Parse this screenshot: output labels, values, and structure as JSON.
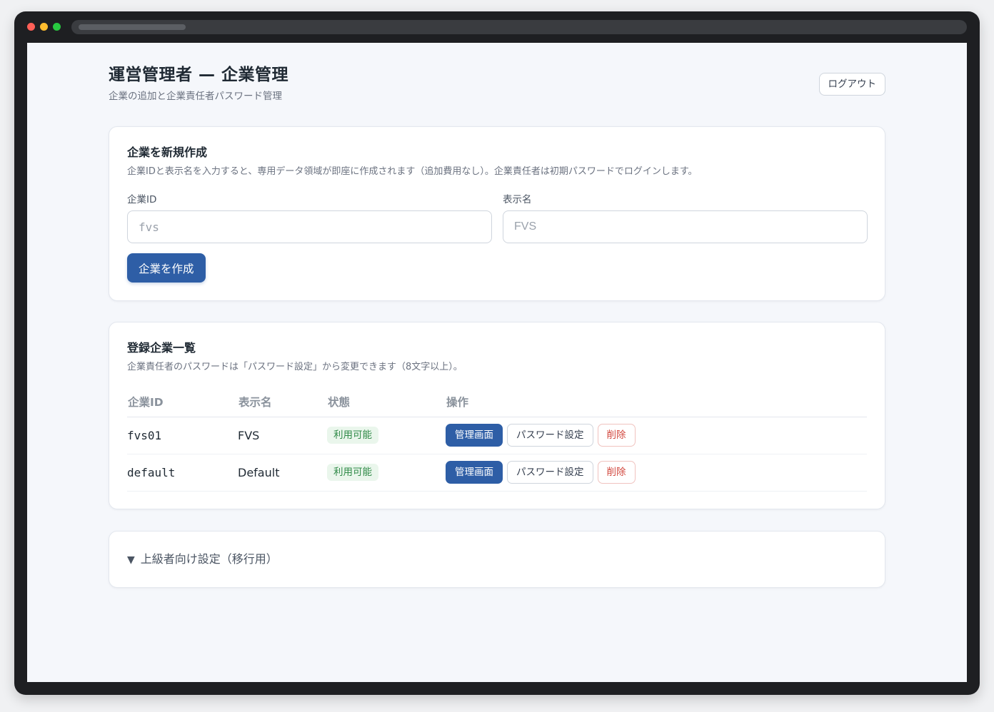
{
  "header": {
    "title": "運営管理者 — 企業管理",
    "subtitle": "企業の追加と企業責任者パスワード管理",
    "logout_label": "ログアウト"
  },
  "create": {
    "title": "企業を新規作成",
    "description": "企業IDと表示名を入力すると、専用データ領域が即座に作成されます（追加費用なし）。企業責任者は初期パスワードでログインします。",
    "id_label": "企業ID",
    "id_placeholder": "fvs",
    "name_label": "表示名",
    "name_placeholder": "FVS",
    "submit_label": "企業を作成"
  },
  "list": {
    "title": "登録企業一覧",
    "description": "企業責任者のパスワードは「パスワード設定」から変更できます（8文字以上）。",
    "columns": [
      "企業ID",
      "表示名",
      "状態",
      "操作"
    ],
    "rows": [
      {
        "id": "fvs01",
        "name": "FVS",
        "status": "利用可能",
        "actions": {
          "admin": "管理画面",
          "password": "パスワード設定",
          "delete": "削除"
        }
      },
      {
        "id": "default",
        "name": "Default",
        "status": "利用可能",
        "actions": {
          "admin": "管理画面",
          "password": "パスワード設定",
          "delete": "削除"
        }
      }
    ]
  },
  "advanced": {
    "arrow_icon": "triangle-down-icon",
    "label": "上級者向け設定（移行用）"
  },
  "colors": {
    "primary": "#2e5ea6",
    "status_green": "#2f8a47",
    "danger": "#d2473d"
  }
}
